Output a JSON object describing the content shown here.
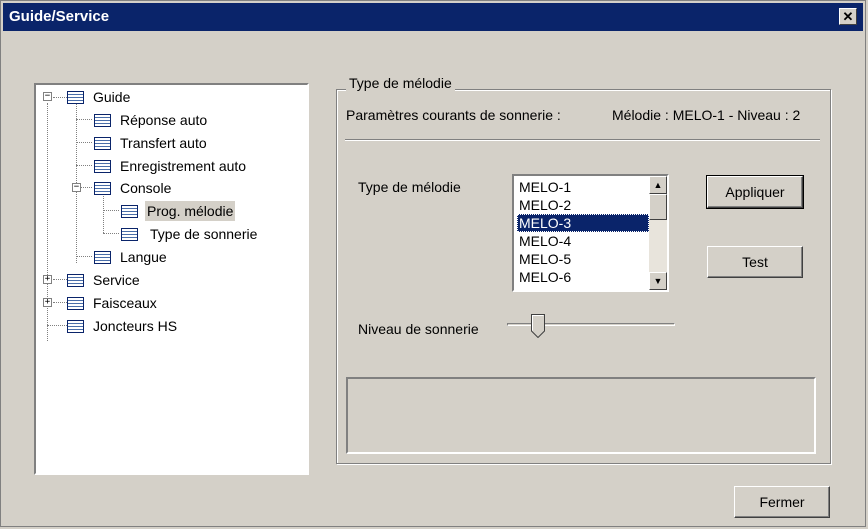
{
  "window": {
    "title": "Guide/Service",
    "close_label": "✕"
  },
  "tree": {
    "items": [
      {
        "label": "Guide",
        "expander": "−"
      },
      {
        "label": "Réponse auto"
      },
      {
        "label": "Transfert auto"
      },
      {
        "label": "Enregistrement auto"
      },
      {
        "label": "Console",
        "expander": "−"
      },
      {
        "label": "Prog. mélodie",
        "selected": true
      },
      {
        "label": "Type de sonnerie"
      },
      {
        "label": "Langue"
      },
      {
        "label": "Service",
        "expander": "+"
      },
      {
        "label": "Faisceaux",
        "expander": "+"
      },
      {
        "label": "Joncteurs HS"
      }
    ]
  },
  "group": {
    "legend": "Type de mélodie",
    "current_params_label": "Paramètres courants de sonnerie :",
    "current_params_value": "Mélodie : MELO-1 - Niveau : 2",
    "melody_type_label": "Type de mélodie",
    "melody_options": [
      "MELO-1",
      "MELO-2",
      "MELO-3",
      "MELO-4",
      "MELO-5",
      "MELO-6"
    ],
    "selected_index": 2,
    "apply_label": "Appliquer",
    "test_label": "Test",
    "ring_level_label": "Niveau de sonnerie"
  },
  "footer": {
    "close_label": "Fermer"
  },
  "colors": {
    "titlebar": "#0a246a",
    "face": "#d4d0c8",
    "selection": "#0a246a"
  }
}
